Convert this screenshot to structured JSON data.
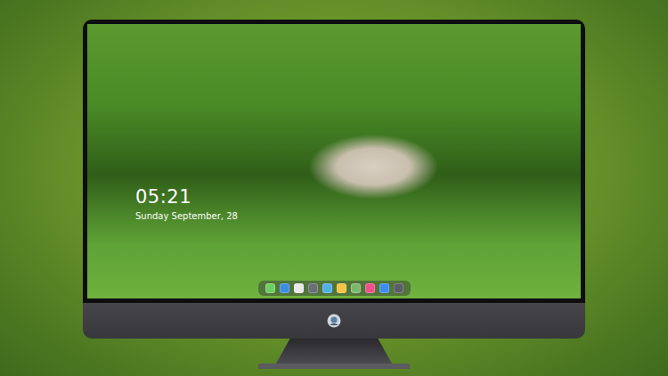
{
  "lock_screen": {
    "time": "05:21",
    "date": "Sunday September, 28"
  },
  "dock": {
    "items": [
      {
        "name": "messages",
        "color": "#6ccf5f"
      },
      {
        "name": "mail",
        "color": "#3b8de0"
      },
      {
        "name": "clock",
        "color": "#e8e8e8"
      },
      {
        "name": "files",
        "color": "#6a6f78"
      },
      {
        "name": "folder",
        "color": "#4fb0e6"
      },
      {
        "name": "notes",
        "color": "#f4c542"
      },
      {
        "name": "photos",
        "color": "#7cb86a"
      },
      {
        "name": "music",
        "color": "#f0508a"
      },
      {
        "name": "store",
        "color": "#3a8ef0"
      },
      {
        "name": "camera",
        "color": "#5a5d63"
      }
    ]
  }
}
